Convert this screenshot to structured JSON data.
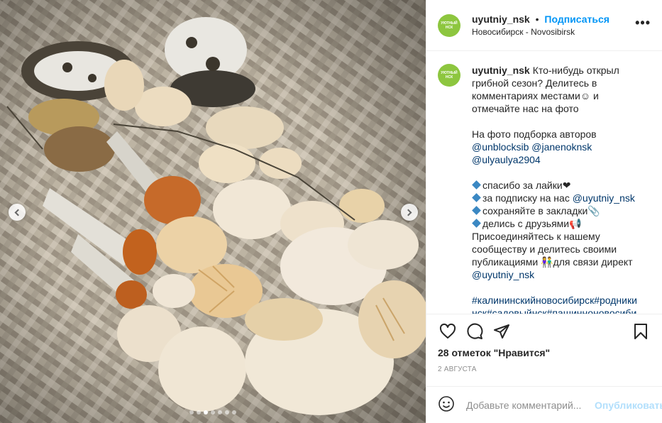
{
  "header": {
    "username": "uyutniy_nsk",
    "separator": "•",
    "follow_label": "Подписаться",
    "location": "Новосибирск - Novosibirsk",
    "more_label": "•••",
    "avatar_text": "УЮТНЫЙ НСК"
  },
  "caption": {
    "username": "uyutniy_nsk",
    "line1_text": "Кто-нибудь открыл грибной сезон? Делитесь в комментариях местами☺ и отмечайте нас на фото",
    "authors_intro": "На фото подборка авторов",
    "author1": "@unblocksib",
    "author2": "@janenoknsk",
    "author3": "@ulyaulya2904",
    "item1": "спасибо за лайки❤",
    "item2_prefix": "за подписку на нас ",
    "item2_mention": "@uyutniy_nsk",
    "item3": "сохраняйте в закладки📎",
    "item4": "делись с друзьями📢",
    "join_text": "Присоединяйтесь к нашему сообществу и делитесь своими публикациями 👫для связи директ",
    "contact_mention": "@uyutniy_nsk",
    "hashtags": "#калининскийновосибирск#родникинск#садовыйнск#пашинноновосибир"
  },
  "actions": {
    "likes_text": "28 отметок \"Нравится\"",
    "date_text": "2 АВГУСТА"
  },
  "comment": {
    "placeholder": "Добавьте комментарий...",
    "publish_label": "Опубликовать"
  },
  "carousel": {
    "total_slides": 7,
    "active_slide": 3
  },
  "colors": {
    "accent": "#0095f6",
    "avatar_bg": "#8dc63f",
    "mention": "#00376b",
    "publish_disabled": "#b2dffc"
  }
}
